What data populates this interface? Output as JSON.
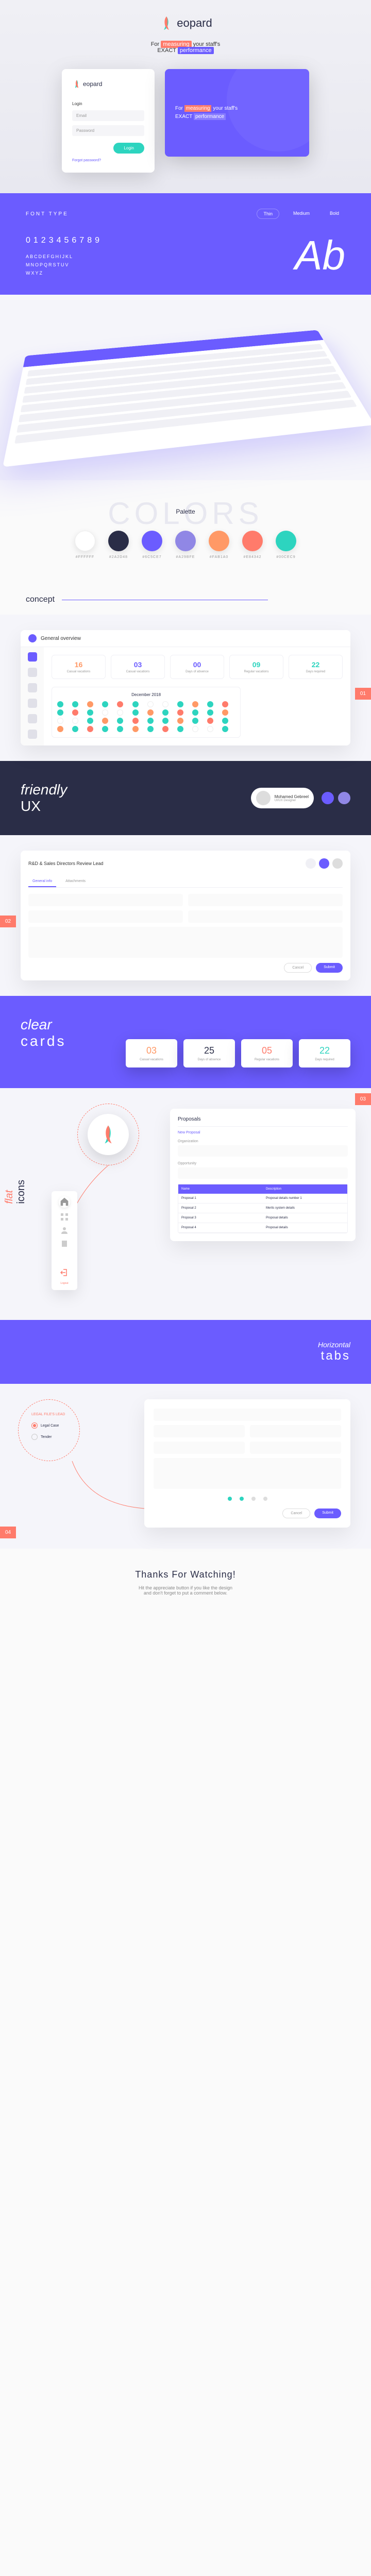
{
  "brand": {
    "name": "eopard",
    "prefix": "L"
  },
  "tagline": {
    "pre": "For ",
    "hl1": "measuring",
    "mid": " your staff's\n",
    "pre2": "EXACT ",
    "hl2": "performance"
  },
  "login": {
    "email": "Email",
    "password": "Password",
    "button": "Login",
    "forgot": "Forgot password?"
  },
  "heroBanner": {
    "line1": "For ",
    "hl1": "measuring",
    "line2": " your staff's",
    "line3": "EXACT ",
    "hl2": "performance"
  },
  "fonts": {
    "label": "FONT TYPE",
    "weights": [
      "Thin",
      "Medium",
      "Bold"
    ],
    "numbers": "0123456789",
    "upper1": "ABCDEFGHIJKL",
    "upper2": "MNOPQRSTUV",
    "upper3": "WXYZ",
    "sample": "Ab"
  },
  "colorsTitle": "COLORS",
  "paletteLabel": "Palette",
  "swatches": [
    {
      "color": "#ffffff",
      "label": "#FFFFFF"
    },
    {
      "color": "#2a2d47",
      "label": "#2A2D48"
    },
    {
      "color": "#6b5cff",
      "label": "#6C5CE7"
    },
    {
      "color": "#9087e5",
      "label": "#A29BFE"
    },
    {
      "color": "#ff9966",
      "label": "#FAB1A0"
    },
    {
      "color": "#ff7b6b",
      "label": "#E84342"
    },
    {
      "color": "#2dd4bf",
      "label": "#00CEC9"
    }
  ],
  "conceptLabel": "concept",
  "sectionNums": {
    "s1": "01",
    "s2": "02",
    "s3": "03",
    "s4": "04"
  },
  "dashboard": {
    "title": "General overview",
    "stats": [
      {
        "num": "16",
        "label": "Casual vacations",
        "cls": "orange"
      },
      {
        "num": "03",
        "label": "Casual vacations",
        "cls": ""
      },
      {
        "num": "00",
        "label": "Days of absence",
        "cls": ""
      },
      {
        "num": "09",
        "label": "Regular vacations",
        "cls": "teal"
      },
      {
        "num": "22",
        "label": "Days required",
        "cls": "teal"
      }
    ],
    "calMonth": "December 2018"
  },
  "ux": {
    "friendly": "friendly",
    "ux": "UX",
    "userName": "Mohamed Gebreel",
    "userRole": "UI/UX Designer"
  },
  "form": {
    "title": "R&D & Sales Directors Review Lead",
    "tabs": [
      "General info",
      "Attachments"
    ],
    "cancel": "Cancel",
    "submit": "Submit"
  },
  "cards": {
    "clear": "clear",
    "cards": "cards",
    "items": [
      {
        "num": "03",
        "label": "Casual vacations",
        "color": "#ff9966"
      },
      {
        "num": "25",
        "label": "Days of absence",
        "color": "#2a2d47"
      },
      {
        "num": "05",
        "label": "Regular vacations",
        "color": "#ff7b6b"
      },
      {
        "num": "22",
        "label": "Days required",
        "color": "#2dd4bf"
      }
    ]
  },
  "icons": {
    "flat": "flat",
    "icons": "icons"
  },
  "proposals": {
    "title": "Proposals",
    "newLabel": "New Proposal",
    "orgLabel": "Organization",
    "oppLabel": "Opportunity",
    "headers": [
      "Name",
      "Description"
    ],
    "rows": [
      {
        "name": "Proposal 1",
        "desc": "Proposal details number 1"
      },
      {
        "name": "Proposal 2",
        "desc": "Merits system details"
      },
      {
        "name": "Proposal 3",
        "desc": "Proposal details"
      },
      {
        "name": "Proposal 4",
        "desc": "Proposal details"
      }
    ],
    "sideIcons": [
      "home",
      "grid",
      "users",
      "file",
      "logout"
    ]
  },
  "tabs": {
    "horizontal": "Horizontal",
    "tabs": "tabs"
  },
  "legal": {
    "title": "LEGAL FILE'S LEAD",
    "opts": [
      "Legal Case",
      "Tender"
    ],
    "cancel": "Cancel",
    "submit": "Submit"
  },
  "thanks": {
    "title": "Thanks For Watching!",
    "sub": "Hit the appreciate button if you like the design\nand don't forget to put a comment below."
  }
}
